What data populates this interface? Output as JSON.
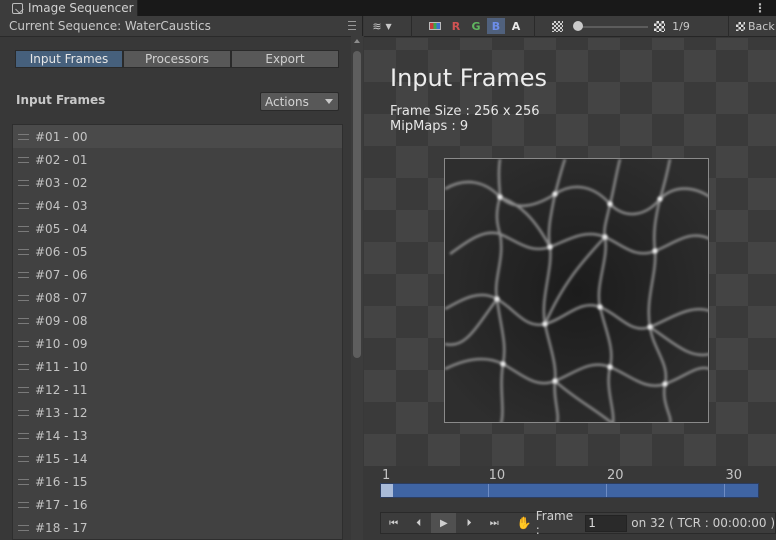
{
  "window": {
    "tab_title": "Image Sequencer",
    "tab_menu": "⋮"
  },
  "left": {
    "current_sequence": "Current Sequence: WaterCaustics",
    "tabs": [
      {
        "label": "Input Frames",
        "active": true
      },
      {
        "label": "Processors",
        "active": false
      },
      {
        "label": "Export",
        "active": false
      }
    ],
    "section_title": "Input Frames",
    "actions_label": "Actions",
    "frames": [
      "#01 - 00",
      "#02 - 01",
      "#03 - 02",
      "#04 - 03",
      "#05 - 04",
      "#06 - 05",
      "#07 - 06",
      "#08 - 07",
      "#09 - 08",
      "#10 - 09",
      "#11 - 10",
      "#12 - 11",
      "#13 - 12",
      "#14 - 13",
      "#15 - 14",
      "#16 - 15",
      "#17 - 16",
      "#18 - 17"
    ],
    "selected_index": 0
  },
  "toolbar": {
    "layers_icon": "layers-icon",
    "channels": {
      "r": "R",
      "g": "G",
      "b": "B",
      "a": "A"
    },
    "active_channel": "B",
    "mip_label": "1/9",
    "mip_level": 0,
    "background_label": "Back"
  },
  "viewport": {
    "title": "Input Frames",
    "frame_size": "Frame Size : 256 x 256",
    "mipmaps": "MipMaps : 9"
  },
  "timeline": {
    "tick_labels": [
      {
        "label": "1",
        "frame": 1
      },
      {
        "label": "10",
        "frame": 10
      },
      {
        "label": "20",
        "frame": 20
      },
      {
        "label": "30",
        "frame": 30
      }
    ],
    "total_frames": 32,
    "current_frame": 1
  },
  "transport": {
    "frame_label": "Frame :",
    "frame_value": "1",
    "total_text": "on 32 ( TCR : 00:00:00 )"
  },
  "colors": {
    "accent": "#46607c",
    "timeline": "#3f64a3",
    "panel": "#383838"
  }
}
